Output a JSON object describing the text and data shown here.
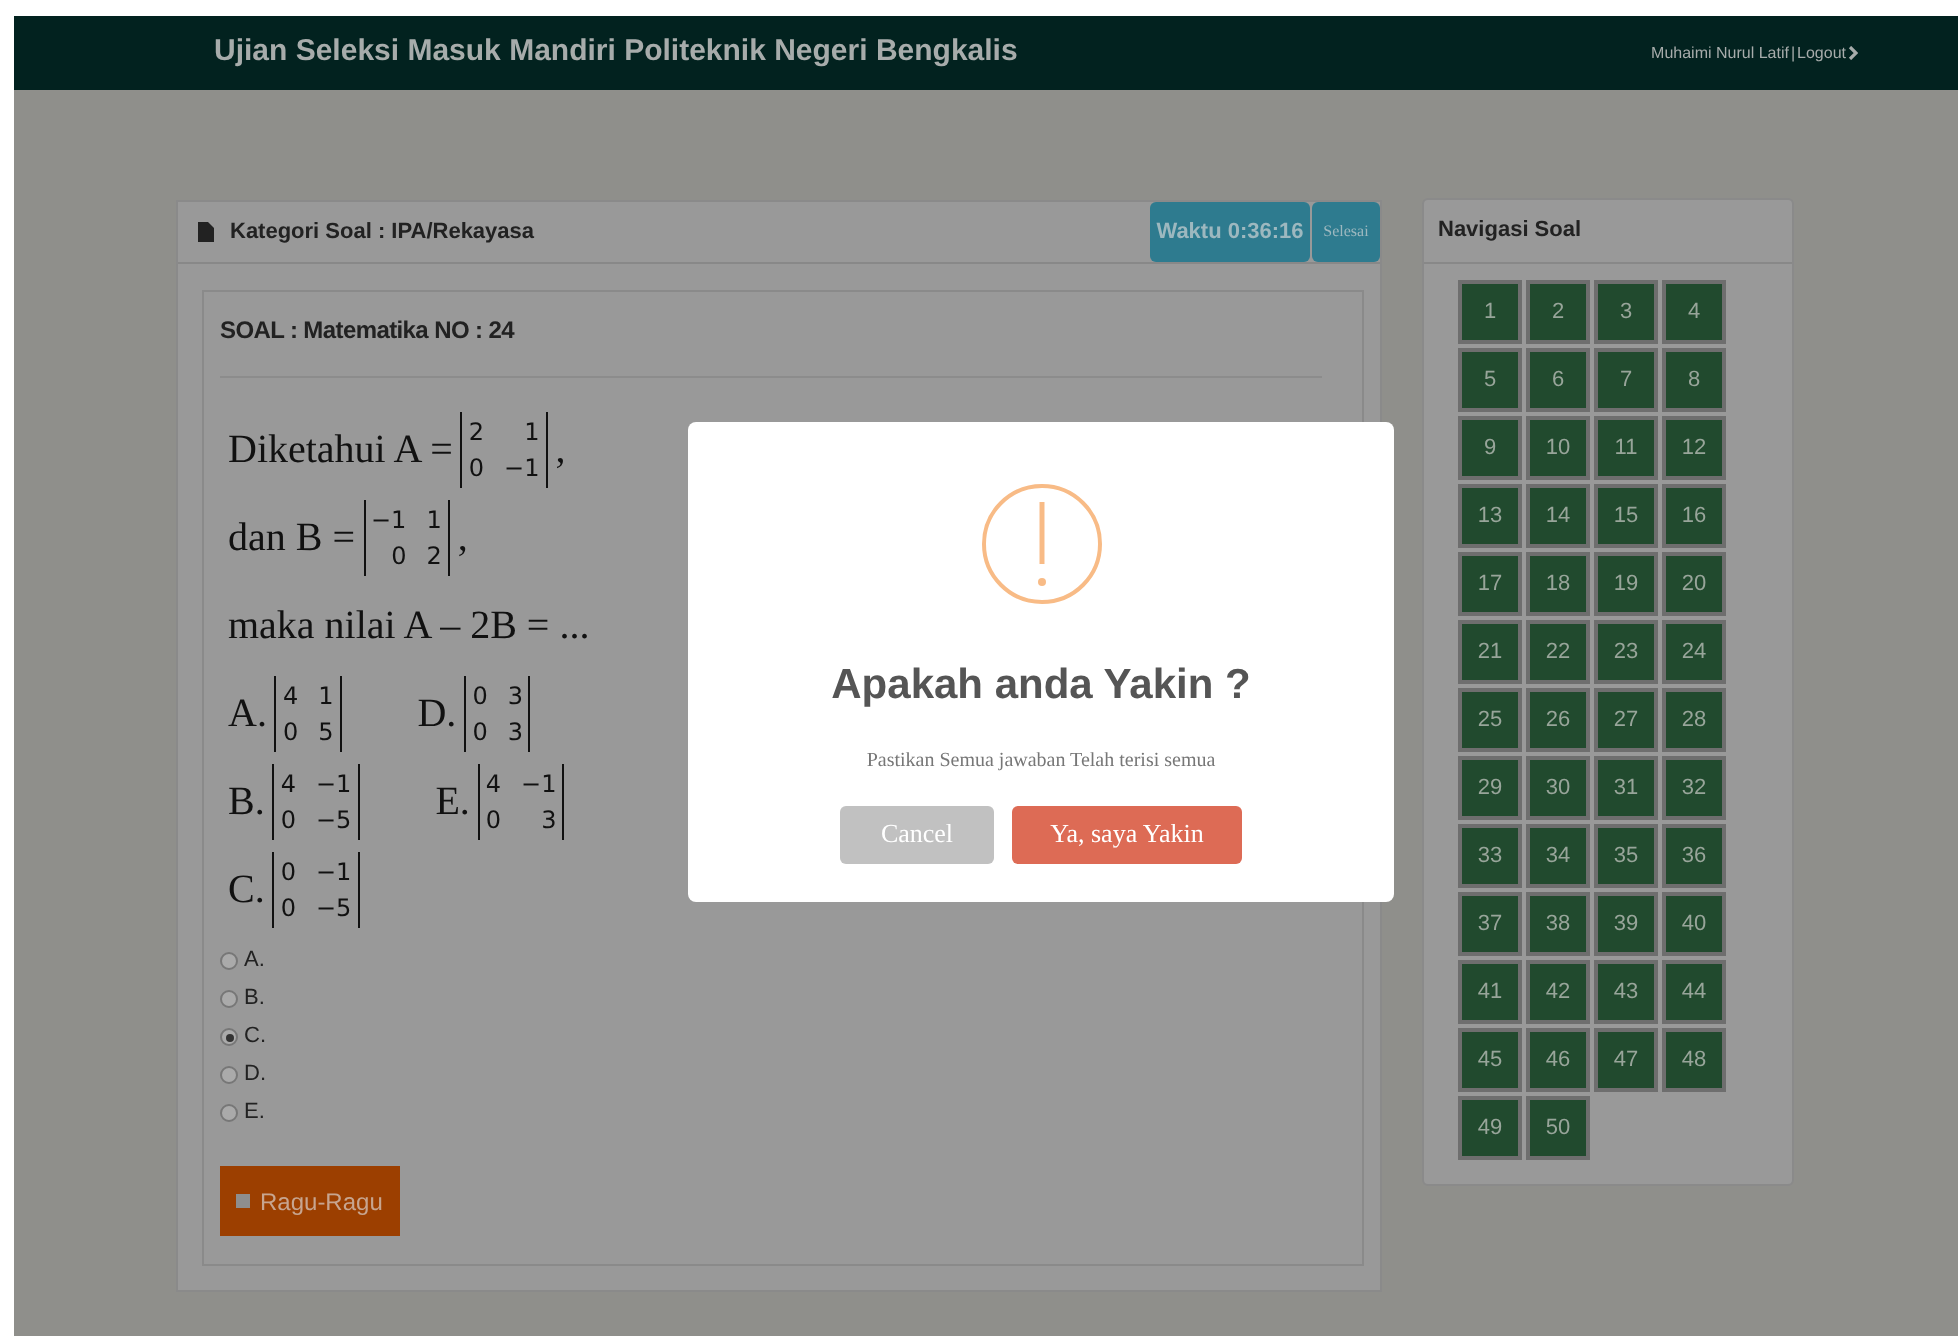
{
  "header": {
    "title": "Ujian Seleksi Masuk Mandiri Politeknik Negeri Bengkalis",
    "user": "Muhaimi Nurul Latif",
    "separator": "|",
    "logout": "Logout"
  },
  "question_panel": {
    "category": "Kategori Soal : IPA/Rekayasa",
    "timer": "Waktu 0:36:16",
    "finish": "Selesai",
    "heading": "SOAL : Matematika NO : 24",
    "question_lines": [
      {
        "parts": [
          {
            "kind": "text",
            "text": "Diketahui A ="
          },
          {
            "kind": "matrix",
            "rows": [
              [
                "2",
                "1"
              ],
              [
                "0",
                "−1"
              ]
            ]
          },
          {
            "kind": "text",
            "text": ","
          }
        ]
      },
      {
        "parts": [
          {
            "kind": "text",
            "text": "dan B ="
          },
          {
            "kind": "matrix",
            "rows": [
              [
                "−1",
                "1"
              ],
              [
                "0",
                "2"
              ]
            ]
          },
          {
            "kind": "text",
            "text": ","
          }
        ]
      },
      {
        "parts": [
          {
            "kind": "text",
            "text": "maka nilai A – 2B = ..."
          }
        ]
      },
      {
        "parts": [
          {
            "kind": "text",
            "text": "A."
          },
          {
            "kind": "matrix",
            "rows": [
              [
                "4",
                "1"
              ],
              [
                "0",
                "5"
              ]
            ]
          },
          {
            "kind": "gap"
          },
          {
            "kind": "text",
            "text": "D."
          },
          {
            "kind": "matrix",
            "rows": [
              [
                "0",
                "3"
              ],
              [
                "0",
                "3"
              ]
            ]
          }
        ]
      },
      {
        "parts": [
          {
            "kind": "text",
            "text": "B."
          },
          {
            "kind": "matrix",
            "rows": [
              [
                "4",
                "−1"
              ],
              [
                "0",
                "−5"
              ]
            ]
          },
          {
            "kind": "gap"
          },
          {
            "kind": "text",
            "text": "E."
          },
          {
            "kind": "matrix",
            "rows": [
              [
                "4",
                "−1"
              ],
              [
                "0",
                "3"
              ]
            ]
          }
        ]
      },
      {
        "parts": [
          {
            "kind": "text",
            "text": "C."
          },
          {
            "kind": "matrix",
            "rows": [
              [
                "0",
                "−1"
              ],
              [
                "0",
                "−5"
              ]
            ]
          }
        ]
      }
    ],
    "options": [
      {
        "label": "A.",
        "selected": false
      },
      {
        "label": "B.",
        "selected": false
      },
      {
        "label": "C.",
        "selected": true
      },
      {
        "label": "D.",
        "selected": false
      },
      {
        "label": "E.",
        "selected": false
      }
    ],
    "doubt_button": "Ragu-Ragu"
  },
  "navigation": {
    "title": "Navigasi Soal",
    "numbers": [
      "1",
      "2",
      "3",
      "4",
      "5",
      "6",
      "7",
      "8",
      "9",
      "10",
      "11",
      "12",
      "13",
      "14",
      "15",
      "16",
      "17",
      "18",
      "19",
      "20",
      "21",
      "22",
      "23",
      "24",
      "25",
      "26",
      "27",
      "28",
      "29",
      "30",
      "31",
      "32",
      "33",
      "34",
      "35",
      "36",
      "37",
      "38",
      "39",
      "40",
      "41",
      "42",
      "43",
      "44",
      "45",
      "46",
      "47",
      "48",
      "49",
      "50"
    ]
  },
  "dialog": {
    "title": "Apakah anda Yakin ?",
    "message": "Pastikan Semua jawaban Telah terisi semua",
    "cancel": "Cancel",
    "confirm": "Ya, saya Yakin"
  }
}
